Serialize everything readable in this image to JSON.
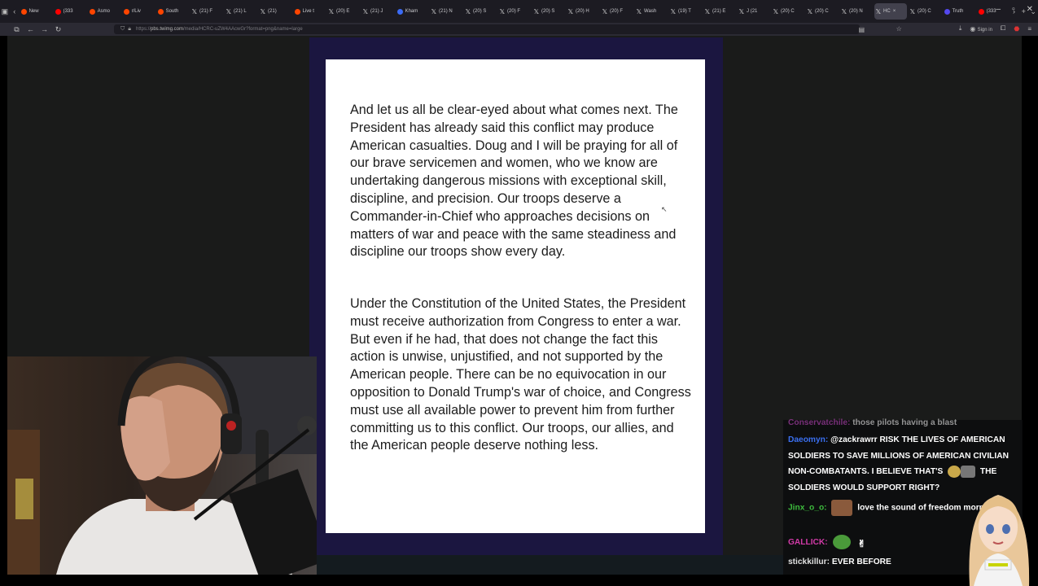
{
  "browser": {
    "tabs": [
      {
        "label": "New",
        "icon": "reddit-icon",
        "color": "#ff4500"
      },
      {
        "label": "(333",
        "icon": "youtube-icon",
        "color": "#ff0000"
      },
      {
        "label": "Asmo",
        "icon": "reddit-icon",
        "color": "#ff4500"
      },
      {
        "label": "r/Liv",
        "icon": "reddit-icon",
        "color": "#ff4500"
      },
      {
        "label": "South",
        "icon": "reddit-icon",
        "color": "#ff4500"
      },
      {
        "label": "(21) F",
        "icon": "x-icon",
        "color": "#ffffff"
      },
      {
        "label": "(21) L",
        "icon": "x-icon",
        "color": "#ffffff"
      },
      {
        "label": "(21) ",
        "icon": "x-icon",
        "color": "#ffffff"
      },
      {
        "label": "Live t",
        "icon": "reddit-icon",
        "color": "#ff4500"
      },
      {
        "label": "(20) E",
        "icon": "x-icon",
        "color": "#ffffff"
      },
      {
        "label": "(21) J",
        "icon": "x-icon",
        "color": "#ffffff"
      },
      {
        "label": "Kham",
        "icon": "news-icon",
        "color": "#3b6bf5"
      },
      {
        "label": "(21) N",
        "icon": "x-icon",
        "color": "#ffffff"
      },
      {
        "label": "(20) S",
        "icon": "x-icon",
        "color": "#ffffff"
      },
      {
        "label": "(20) F",
        "icon": "x-icon",
        "color": "#ffffff"
      },
      {
        "label": "(20) S",
        "icon": "x-icon",
        "color": "#ffffff"
      },
      {
        "label": "(20) H",
        "icon": "x-icon",
        "color": "#ffffff"
      },
      {
        "label": "(20) F",
        "icon": "x-icon",
        "color": "#ffffff"
      },
      {
        "label": "Wash",
        "icon": "x-icon",
        "color": "#ffffff"
      },
      {
        "label": "(19) T",
        "icon": "x-icon",
        "color": "#ffffff"
      },
      {
        "label": "(21) E",
        "icon": "x-icon",
        "color": "#ffffff"
      },
      {
        "label": "J (21",
        "icon": "x-icon",
        "color": "#ffffff"
      },
      {
        "label": "(20) C",
        "icon": "x-icon",
        "color": "#ffffff"
      },
      {
        "label": "(20) C",
        "icon": "x-icon",
        "color": "#ffffff"
      },
      {
        "label": "(20) N",
        "icon": "x-icon",
        "color": "#ffffff"
      },
      {
        "label": "HC",
        "icon": "x-icon",
        "color": "#ffffff",
        "active": true
      },
      {
        "label": "(20) C",
        "icon": "x-icon",
        "color": "#ffffff"
      },
      {
        "label": "Truth",
        "icon": "truth-icon",
        "color": "#5448ee"
      },
      {
        "label": "(333",
        "icon": "youtube-icon",
        "color": "#ff0000"
      }
    ],
    "url_host": "pbs.twimg.com",
    "url_path": "/media/HCRC-uZW4AAcwGr?format=png&name=large",
    "url_prefix": "https://",
    "sign_in": "Sign in"
  },
  "document": {
    "paragraph_1": "And let us all be clear-eyed about what comes next. The President has already said this conflict may produce American casualties. Doug and I will be praying for all of our brave servicemen and women, who we know are undertaking dangerous missions with exceptional skill, discipline, and precision. Our troops deserve a Commander-in-Chief who approaches decisions on matters of war and peace with the same steadiness and discipline our troops show every day.",
    "paragraph_2": "Under the Constitution of the United States, the President must receive authorization from Congress to enter a war. But even if he had, that does not change the fact this action is unwise, unjustified, and not supported by the American people. There can be no equivocation in our opposition to Donald Trump's war of choice, and Congress must use all available power to prevent him from further committing us to this conflict. Our troops, our allies, and the American people deserve nothing less."
  },
  "chat": {
    "messages": [
      {
        "user": "Conservatchile:",
        "user_color": "#d04bd0",
        "text": "those pilots having a blast"
      },
      {
        "user": "Daeomyn:",
        "user_color": "#3a6ff0",
        "text": "@zackrawrr RISK THE LIVES OF AMERICAN SOLDIERS TO SAVE MILLIONS OF AMERICAN CIVILIAN NON-COMBATANTS. I BELIEVE THAT'S",
        "text_after": "THE SOLDIERS WOULD SUPPORT RIGHT?"
      },
      {
        "user": "Jinx_o_o:",
        "user_color": "#3dbb3d",
        "text": "love the sound of freedom morning"
      },
      {
        "user": "GALLICK:",
        "user_color": "#d23aa8",
        "text": ""
      },
      {
        "user": "stickkillur:",
        "user_color": "#e0e0e0",
        "text": "EVER BEFORE"
      }
    ]
  },
  "colors": {
    "doc_frame": "#1b1640",
    "viewer_bg": "#1a1b1a",
    "tabbar_bg": "#1c1b22"
  }
}
